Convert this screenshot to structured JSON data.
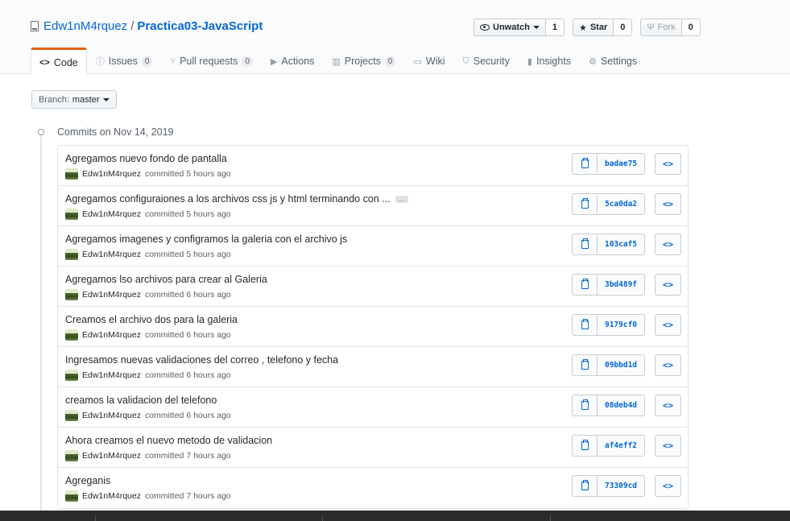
{
  "repo": {
    "owner": "Edw1nM4rquez",
    "separator": "/",
    "name": "Practica03-JavaScript"
  },
  "actions": {
    "unwatch_label": "Unwatch",
    "watch_count": "1",
    "star_label": "Star",
    "star_count": "0",
    "fork_label": "Fork",
    "fork_count": "0"
  },
  "tabs": [
    {
      "label": "Code",
      "icon": "code-icon",
      "count": ""
    },
    {
      "label": "Issues",
      "icon": "issue-icon",
      "count": "0"
    },
    {
      "label": "Pull requests",
      "icon": "pull-request-icon",
      "count": "0"
    },
    {
      "label": "Actions",
      "icon": "play-icon",
      "count": ""
    },
    {
      "label": "Projects",
      "icon": "project-icon",
      "count": "0"
    },
    {
      "label": "Wiki",
      "icon": "book-icon",
      "count": ""
    },
    {
      "label": "Security",
      "icon": "shield-icon",
      "count": ""
    },
    {
      "label": "Insights",
      "icon": "graph-icon",
      "count": ""
    },
    {
      "label": "Settings",
      "icon": "gear-icon",
      "count": ""
    }
  ],
  "branch": {
    "prefix": "Branch:",
    "name": "master"
  },
  "commit_group_title": "Commits on Nov 14, 2019",
  "ellipsis_label": "…",
  "commits": [
    {
      "message": "Agregamos nuevo fondo de pantalla",
      "author": "Edw1nM4rquez",
      "when": "committed 5 hours ago",
      "sha": "badae75",
      "truncated": false
    },
    {
      "message": "Agregamos configuraiones a los archivos css js y html terminando con ...",
      "author": "Edw1nM4rquez",
      "when": "committed 5 hours ago",
      "sha": "5ca0da2",
      "truncated": true
    },
    {
      "message": "Agregamos imagenes y configramos la galeria con el archivo js",
      "author": "Edw1nM4rquez",
      "when": "committed 5 hours ago",
      "sha": "103caf5",
      "truncated": false
    },
    {
      "message": "Agregamos lso archivos para crear al Galeria",
      "author": "Edw1nM4rquez",
      "when": "committed 6 hours ago",
      "sha": "3bd489f",
      "truncated": false
    },
    {
      "message": "Creamos el archivo dos para la galeria",
      "author": "Edw1nM4rquez",
      "when": "committed 6 hours ago",
      "sha": "9179cf0",
      "truncated": false
    },
    {
      "message": "Ingresamos nuevas validaciones del correo , telefono y fecha",
      "author": "Edw1nM4rquez",
      "when": "committed 6 hours ago",
      "sha": "09bbd1d",
      "truncated": false
    },
    {
      "message": "creamos la validacion del telefono",
      "author": "Edw1nM4rquez",
      "when": "committed 6 hours ago",
      "sha": "08deb4d",
      "truncated": false
    },
    {
      "message": "Ahora creamos el nuevo metodo de validacion",
      "author": "Edw1nM4rquez",
      "when": "committed 7 hours ago",
      "sha": "af4eff2",
      "truncated": false
    },
    {
      "message": "Agreganis",
      "author": "Edw1nM4rquez",
      "when": "committed 7 hours ago",
      "sha": "73309cd",
      "truncated": false
    }
  ]
}
